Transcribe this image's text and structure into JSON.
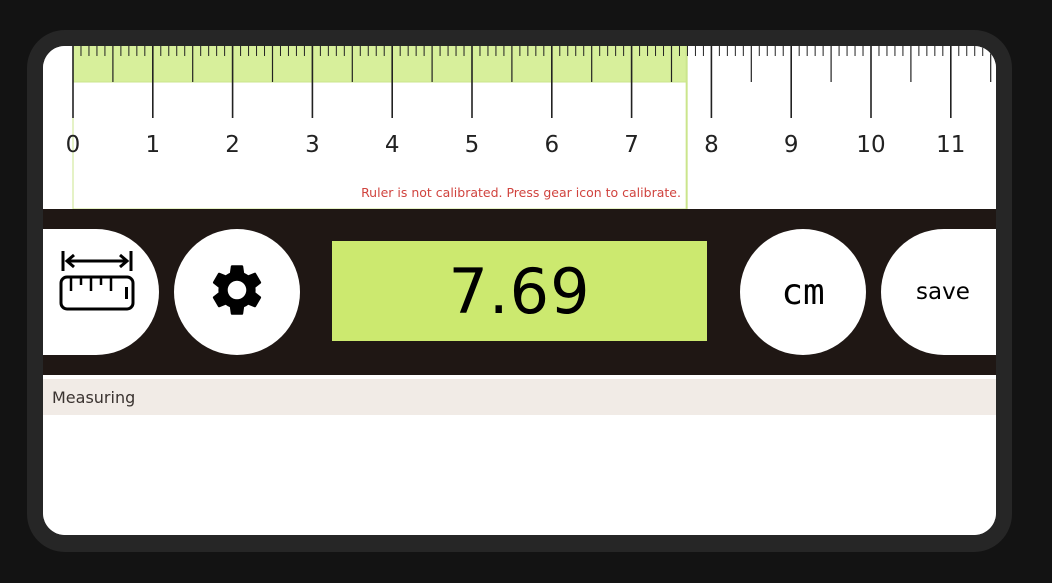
{
  "ruler": {
    "unit": "cm",
    "labels": [
      "0",
      "1",
      "2",
      "3",
      "4",
      "5",
      "6",
      "7",
      "8",
      "9",
      "10",
      "11"
    ],
    "measured_length": 7.69,
    "highlight_color": "#d7ef9b",
    "warning": "Ruler is not calibrated. Press gear icon to calibrate."
  },
  "controls": {
    "calibrate_icon": "ruler-calibrate-icon",
    "settings_icon": "gear-icon",
    "readout_value": "7.69",
    "readout_color": "#cce96f",
    "unit_label": "cm",
    "save_label": "save"
  },
  "status": {
    "label": "Measuring"
  }
}
